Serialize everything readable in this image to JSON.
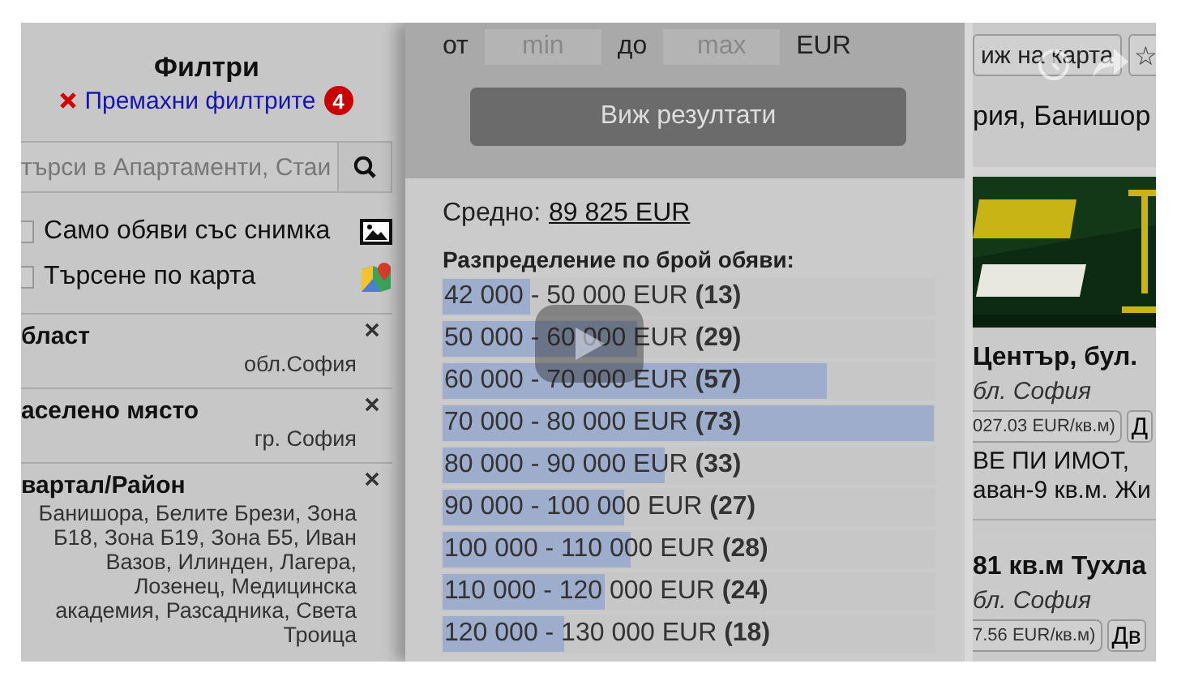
{
  "filters": {
    "title": "Филтри",
    "clear_link": "Премахни филтрите",
    "badge": "4",
    "search": {
      "placeholder": "търси в Апартаменти, Стаи"
    },
    "options": [
      {
        "label": "Само обяви със снимка",
        "checked": false
      },
      {
        "label": "Търсене по карта",
        "checked": false,
        "kind": "map"
      }
    ],
    "sections": [
      {
        "title": "бласт",
        "value": "обл.София"
      },
      {
        "title": "аселено място",
        "value": "гр. София"
      },
      {
        "title": "вартал/Район",
        "value": "Банишора, Белите Брези, Зона Б18, Зона Б19, Зона Б5, Иван Вазов, Илинден, Лагера, Лозенец, Медицинска академия, Разсадника, Света Троица"
      }
    ]
  },
  "price": {
    "from_label": "от",
    "from_placeholder": "min",
    "to_label": "до",
    "to_placeholder": "max",
    "currency": "EUR",
    "button": "Виж резултати",
    "average_label": "Средно:",
    "average_value": "89 825 EUR",
    "distribution_title": "Разпределение по брой обяви:",
    "bins": [
      {
        "range": "42 000 - 50 000 EUR",
        "count": "(13)",
        "level": 0.178
      },
      {
        "range": "50 000 - 60 000 EUR",
        "count": "(29)",
        "level": 0.397
      },
      {
        "range": "60 000 - 70 000 EUR",
        "count": "(57)",
        "level": 0.781
      },
      {
        "range": "70 000 - 80 000 EUR",
        "count": "(73)",
        "level": 1
      },
      {
        "range": "80 000 - 90 000 EUR",
        "count": "(33)",
        "level": 0.452
      },
      {
        "range": "90 000 - 100 000 EUR",
        "count": "(27)",
        "level": 0.37
      },
      {
        "range": "100 000 - 110 000 EUR",
        "count": "(28)",
        "level": 0.384
      },
      {
        "range": "110 000 - 120 000 EUR",
        "count": "(24)",
        "level": 0.329
      },
      {
        "range": "120 000 - 130 000 EUR",
        "count": "(18)",
        "level": 0.247
      }
    ]
  },
  "results": {
    "map_button": "иж на карта",
    "star": "☆",
    "location": "рия, Банишор",
    "ads": [
      {
        "title": "Център, бул.",
        "place": "бл. София",
        "price_per_m2": "027.03 EUR/кв.м)",
        "type_button": "Д",
        "description": [
          "ВЕ ПИ ИМОТ,",
          "аван-9 кв.м. Жи"
        ]
      },
      {
        "title": "81 кв.м Тухла",
        "place": "бл. София",
        "price_per_m2": "7.56 EUR/кв.м)",
        "type_button": "Дв"
      }
    ]
  }
}
